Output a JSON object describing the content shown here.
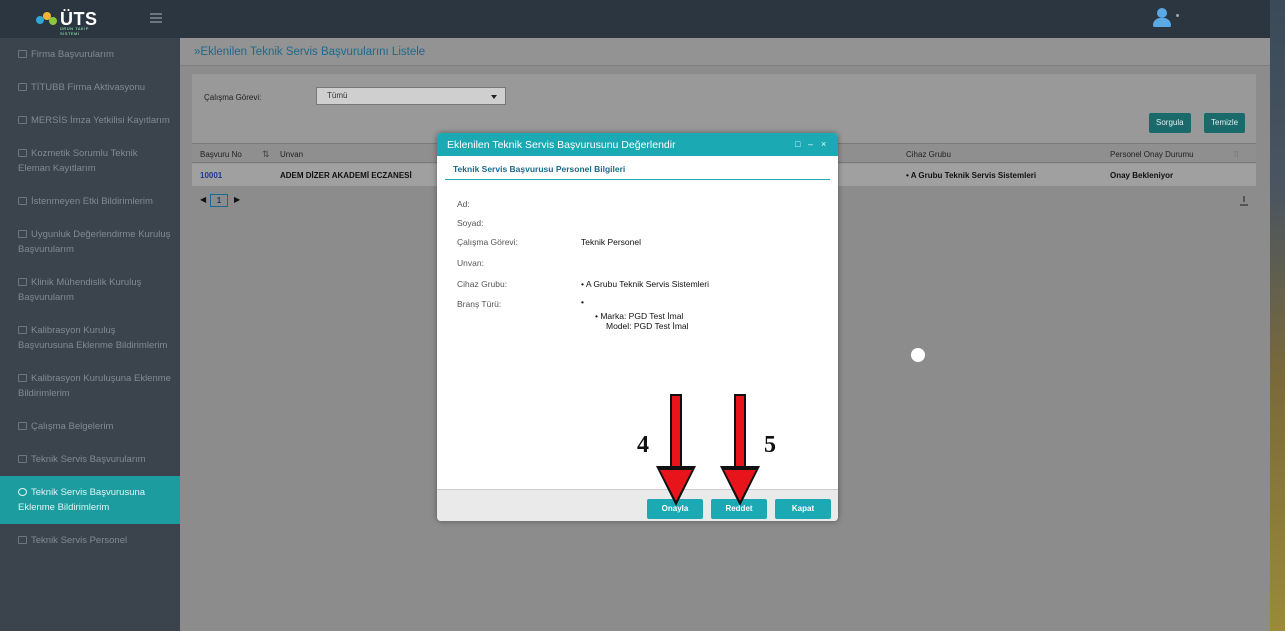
{
  "app": {
    "logo_text": "ÜTS",
    "logo_sub": "ÜRÜN TAKİP SİSTEMİ"
  },
  "sidebar": {
    "items": [
      {
        "label": "Firma Başvurularım"
      },
      {
        "label": "TİTUBB Firma Aktivasyonu"
      },
      {
        "label": "MERSİS İmza Yetkilisi Kayıtlarım"
      },
      {
        "label": "Kozmetik Sorumlu Teknik Eleman Kayıtlarım"
      },
      {
        "label": "İstenmeyen Etki Bildirimlerim"
      },
      {
        "label": "Uygunluk Değerlendirme Kuruluş Başvurularım"
      },
      {
        "label": "Klinik Mühendislik Kuruluş Başvurularım"
      },
      {
        "label": "Kalibrasyon Kuruluş Başvurusuna Eklenme Bildirimlerim"
      },
      {
        "label": "Kalibrasyon Kuruluşuna Eklenme Bildirimlerim"
      },
      {
        "label": "Çalışma Belgelerim"
      },
      {
        "label": "Teknik Servis Başvurularım"
      },
      {
        "label": "Teknik Servis Başvurusuna Eklenme Bildirimlerim"
      },
      {
        "label": "Teknik Servis Personel"
      }
    ]
  },
  "main": {
    "title": "»Eklenilen Teknik Servis Başvurularını Listele",
    "filter": {
      "label": "Çalışma Görevi:",
      "select_value": "Tümü"
    },
    "buttons": {
      "query": "Sorgula",
      "clear": "Temizle"
    },
    "table": {
      "headers": {
        "basvuru_no": "Başvuru No",
        "unvan": "Unvan",
        "cihaz_grubu": "Cihaz Grubu",
        "personel_onay": "Personel Onay Durumu"
      },
      "rows": [
        {
          "basvuru_no": "10001",
          "unvan": "ADEM DİZER AKADEMİ ECZANESİ",
          "cihaz_grubu": "• A Grubu Teknik Servis Sistemleri",
          "personel_onay": "Onay Bekleniyor"
        }
      ]
    },
    "pager": {
      "current_page": "1"
    }
  },
  "modal": {
    "title": "Eklenilen Teknik Servis Başvurusunu Değerlendir",
    "subtitle": "Teknik Servis Başvurusu Personel Bilgileri",
    "fields": {
      "ad_label": "Ad:",
      "ad_value": "",
      "soyad_label": "Soyad:",
      "soyad_value": "",
      "gorev_label": "Çalışma Görevi:",
      "gorev_value": "Teknik Personel",
      "unvan_label": "Unvan:",
      "unvan_value": "",
      "cihaz_label": "Cihaz Grubu:",
      "cihaz_value": "• A Grubu Teknik Servis Sistemleri",
      "brans_label": "Branş Türü:",
      "brans_value": "•",
      "marka": "• Marka: PGD Test İmal",
      "model": "Model: PGD Test İmal"
    },
    "buttons": {
      "approve": "Onayla",
      "reject": "Reddet",
      "close": "Kapat"
    }
  },
  "annotations": {
    "label_4": "4",
    "label_5": "5",
    "arrow_color": "#e8141c"
  }
}
